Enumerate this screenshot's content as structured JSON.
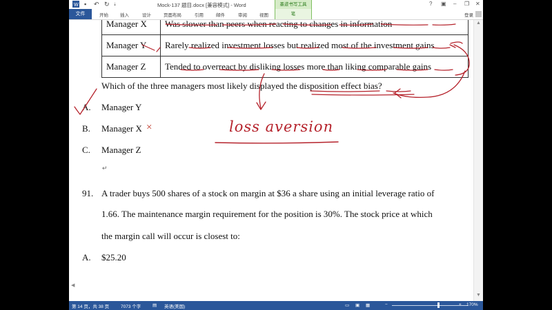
{
  "title_bar": {
    "document_title": "Mock-137 题目.docx [兼容模式] - Word",
    "context_tab_title": "墨迹书写工具",
    "help": "?"
  },
  "ribbon": {
    "file": "文件",
    "tabs": [
      "开始",
      "插入",
      "设计",
      "页面布局",
      "引用",
      "邮件",
      "审阅",
      "视图"
    ],
    "context_subtab": "笔",
    "login": "登录"
  },
  "document": {
    "table_rows": [
      {
        "manager": "Manager X",
        "desc": "Was slower than peers when reacting to changes in information"
      },
      {
        "manager": "Manager Y",
        "desc": "Rarely realized investment losses but realized most of the investment gains"
      },
      {
        "manager": "Manager Z",
        "desc": "Tended to overreact by disliking losses more than liking comparable gains"
      }
    ],
    "question": "Which of the three managers most likely displayed the disposition effect bias?",
    "options": [
      {
        "letter": "A.",
        "text": "Manager Y"
      },
      {
        "letter": "B.",
        "text": "Manager X"
      },
      {
        "letter": "C.",
        "text": "Manager Z"
      }
    ],
    "q91": {
      "number": "91.",
      "line1": "A trader buys 500 shares of a stock on margin at $36 a share using an initial leverage ratio of",
      "line2": "1.66. The maintenance margin requirement for the position is 30%. The stock price at which",
      "line3": "the margin call will occur is closest to:",
      "option_letter": "A.",
      "option_text": "$25.20"
    },
    "handwriting": "loss aversion",
    "cross_mark": "×"
  },
  "status_bar": {
    "page": "第 14 页，共 38 页",
    "words": "7073 个字",
    "language": "英语(美国)",
    "zoom": "170%"
  },
  "colors": {
    "word_blue": "#2b579a",
    "ink_red": "#b5222b",
    "context_green": "#d6ecc8"
  }
}
